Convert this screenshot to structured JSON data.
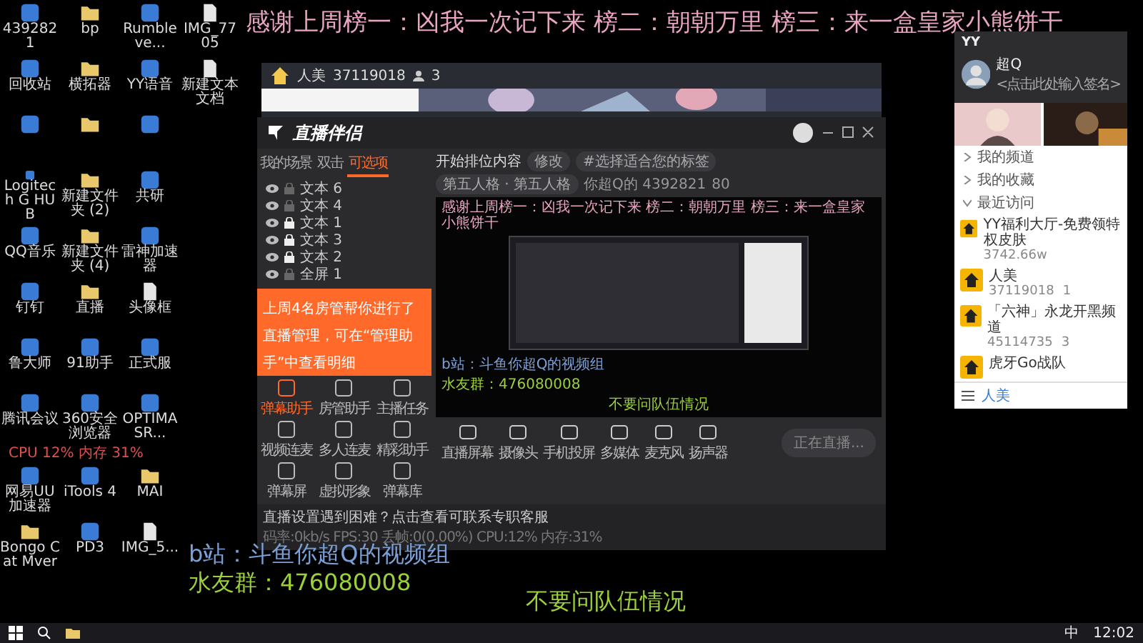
{
  "banner": "感谢上周榜一：凶我一次记下来 榜二：朝朝万里 榜三：来一盒皇家小熊饼干",
  "desktop_rows": [
    [
      {
        "kind": "app",
        "label": "4392821"
      },
      {
        "kind": "folder",
        "label": "bp"
      },
      {
        "kind": "app",
        "label": "Rumbleve..."
      },
      {
        "kind": "file",
        "label": "IMG_7705"
      }
    ],
    [
      {
        "kind": "app",
        "label": "回收站"
      },
      {
        "kind": "folder",
        "label": "横拓器"
      },
      {
        "kind": "app",
        "label": "YY语音"
      },
      {
        "kind": "file",
        "label": "新建文本文档"
      }
    ],
    [
      {
        "kind": "app"
      },
      {
        "kind": "folder"
      },
      {
        "kind": "app"
      }
    ],
    [
      {
        "kind": "app",
        "label": "Logitech G HUB"
      },
      {
        "kind": "folder",
        "label": "新建文件夹 (2)"
      },
      {
        "kind": "app",
        "label": "共研"
      }
    ],
    [
      {
        "kind": "app",
        "label": "QQ音乐"
      },
      {
        "kind": "folder",
        "label": "新建文件夹 (4)"
      },
      {
        "kind": "app",
        "label": "雷神加速器"
      }
    ],
    [
      {
        "kind": "app",
        "label": "钉钉"
      },
      {
        "kind": "folder",
        "label": "直播"
      },
      {
        "kind": "file",
        "label": "头像框"
      }
    ],
    [
      {
        "kind": "app",
        "label": "鲁大师"
      },
      {
        "kind": "app",
        "label": "91助手"
      },
      {
        "kind": "app",
        "label": "正式服"
      }
    ],
    [
      {
        "kind": "app",
        "label": "腾讯会议"
      },
      {
        "kind": "app",
        "label": "360安全浏览器"
      },
      {
        "kind": "app",
        "label": "OPTIMASR..."
      }
    ],
    [
      {
        "kind": "app",
        "label": "网易UU加速器"
      },
      {
        "kind": "app",
        "label": "iTools 4"
      },
      {
        "kind": "folder",
        "label": "MAI"
      }
    ],
    [
      {
        "kind": "folder",
        "label": "Bongo Cat Mver"
      },
      {
        "kind": "app",
        "label": "PD3"
      },
      {
        "kind": "file",
        "label": "IMG_5..."
      }
    ]
  ],
  "perf": "CPU 12% 内存 31%",
  "host_window": {
    "room": "人美",
    "room_id": "37119018",
    "viewers": "3"
  },
  "app": {
    "logo": "直播伴侣",
    "tabs": [
      {
        "label": "我的场景",
        "selected": false
      },
      {
        "label": "双击",
        "selected": false
      },
      {
        "label": "可选项",
        "selected": true
      }
    ],
    "layers": [
      {
        "name": "文本 6",
        "locked": false
      },
      {
        "name": "文本 4",
        "locked": false
      },
      {
        "name": "文本 1",
        "locked": true
      },
      {
        "name": "文本 3",
        "locked": true
      },
      {
        "name": "文本 2",
        "locked": true
      },
      {
        "name": "全屏 1",
        "locked": false
      }
    ],
    "notice": "上周4名房管帮你进行了直播管理，可在“管理助手”中查看明细",
    "tools": [
      "弹幕助手",
      "房管助手",
      "主播任务",
      "视频连麦",
      "多人连麦",
      "精彩助手",
      "弹幕屏",
      "虚拟形象",
      "弹幕库"
    ],
    "title": "开始排位内容",
    "edit": "修改",
    "tag": "#选择适合您的标签",
    "category": "第五人格 · 第五人格",
    "streamer": "你超Q的 4392821",
    "heat": "80",
    "preview": {
      "banner": "感谢上周榜一：凶我一次记下来 榜二：朝朝万里 榜三：来一盒皇家小熊饼干",
      "bilibili": "b站：斗鱼你超Q的视频组",
      "group": "水友群：476080008",
      "note": "不要问队伍情况"
    },
    "controls": [
      "直播屏幕",
      "摄像头",
      "手机投屏",
      "多媒体",
      "麦克风",
      "扬声器"
    ],
    "start": "正在直播...",
    "tip": "直播设置遇到困难？点击查看可联系专职客服",
    "stats": "码率:0kb/s FPS:30 丢帧:0(0.00%) CPU:12% 内存:31%"
  },
  "yy": {
    "title": "YY",
    "name": "超Q",
    "signature": "<点击此处输入签名>",
    "tree": [
      {
        "label": "我的频道",
        "expanded": false
      },
      {
        "label": "我的收藏",
        "expanded": false
      },
      {
        "label": "最近访问",
        "expanded": true
      }
    ],
    "channels": [
      {
        "title": "YY福利大厅-免费领特权皮肤",
        "id": "3742.66w"
      },
      {
        "title": "人美",
        "id": "37119018",
        "count": "1"
      },
      {
        "title": "「六神」永龙开黑频道",
        "id": "45114735",
        "count": "3"
      },
      {
        "title": "虎牙Go战队"
      }
    ],
    "footer": "人美"
  },
  "overlay": {
    "bilibili": "b站：斗鱼你超Q的视频组",
    "group": "水友群：476080008",
    "note": "不要问队伍情况"
  },
  "taskbar": {
    "ime": "中",
    "clock": "12:02"
  }
}
